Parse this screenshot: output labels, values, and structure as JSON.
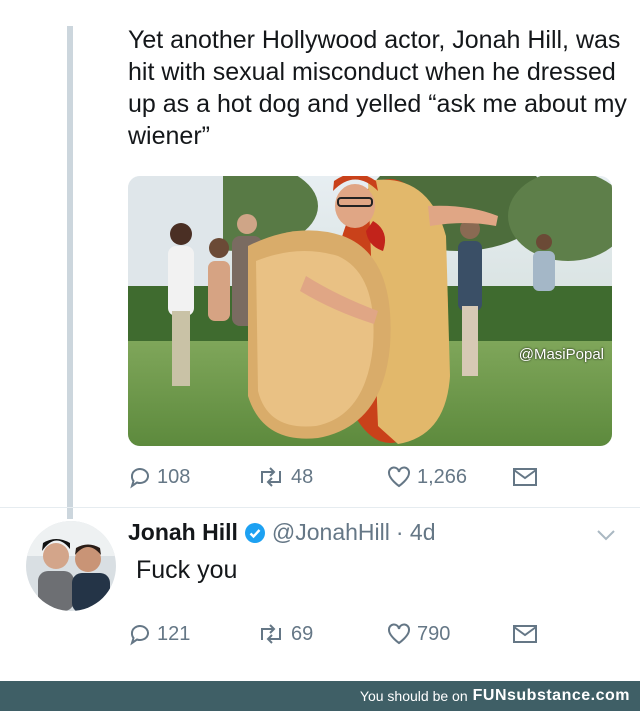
{
  "tweet": {
    "text": "Yet another Hollywood actor, Jonah Hill, was hit with sexual misconduct when he dressed up as a hot dog and yelled “ask me about my wiener”",
    "media_watermark": "@MasiPopal",
    "replies": "108",
    "retweets": "48",
    "likes": "1,266"
  },
  "reply": {
    "name": "Jonah Hill",
    "handle": "@JonahHill",
    "time": "· 4d",
    "text": "Fuck you",
    "replies": "121",
    "retweets": "69",
    "likes": "790"
  },
  "footer": {
    "text": "You should be on",
    "brand": "FUNsubstance.com"
  },
  "icons": {
    "reply": "speech-bubble-icon",
    "retweet": "retweet-icon",
    "like": "heart-icon",
    "dm": "envelope-icon",
    "verified": "verified-badge-icon",
    "caret": "chevron-down-icon"
  },
  "colors": {
    "text": "#14171a",
    "muted": "#657786",
    "thread_line": "#ccd6dd",
    "verified": "#1da1f2",
    "footer_bg": "#3f5f66"
  }
}
